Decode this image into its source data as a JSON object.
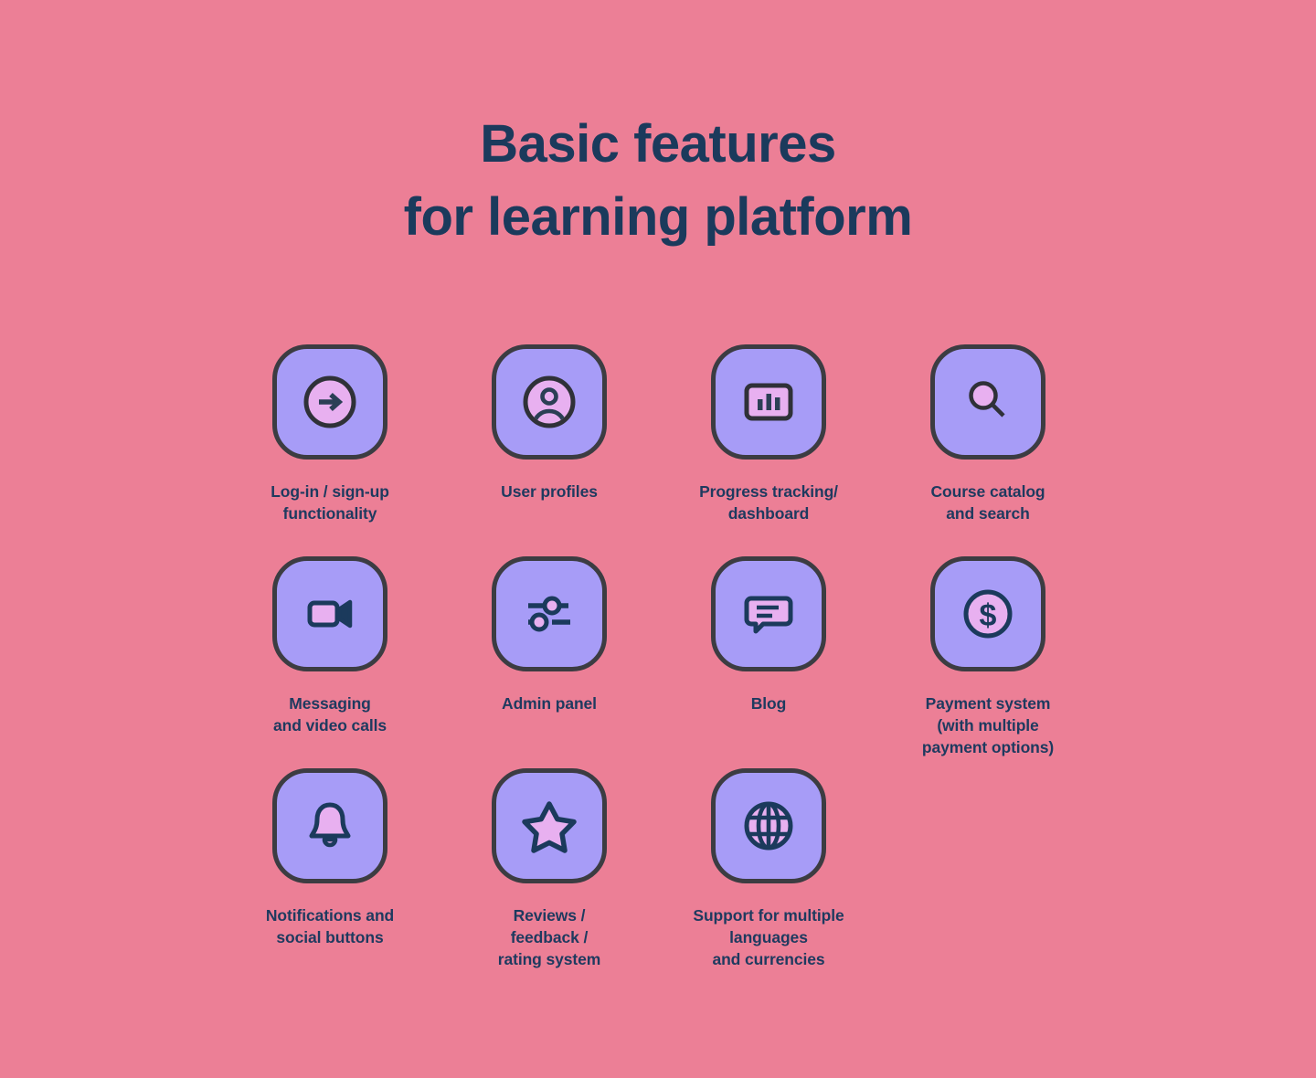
{
  "theme": {
    "background": "#ec7f96",
    "tile_fill": "#a79cf7",
    "tile_border": "#3c3c42",
    "icon_stroke": "#1b3a5c",
    "icon_accent": "#e8b0f0",
    "text": "#1e3a5f"
  },
  "header": {
    "title_line1": "Basic features",
    "title_line2": "for learning platform"
  },
  "features": [
    {
      "icon": "arrow-right-circle-icon",
      "caption_lines": [
        "Log-in / sign-up",
        "functionality"
      ]
    },
    {
      "icon": "user-profile-icon",
      "caption_lines": [
        "User profiles"
      ]
    },
    {
      "icon": "bar-chart-dashboard-icon",
      "caption_lines": [
        "Progress tracking/",
        "dashboard"
      ]
    },
    {
      "icon": "search-magnifier-icon",
      "caption_lines": [
        "Course catalog",
        "and search"
      ]
    },
    {
      "icon": "video-camera-icon",
      "caption_lines": [
        "Messaging",
        "and video calls"
      ]
    },
    {
      "icon": "sliders-settings-icon",
      "caption_lines": [
        "Admin panel"
      ]
    },
    {
      "icon": "chat-bubble-icon",
      "caption_lines": [
        "Blog"
      ]
    },
    {
      "icon": "dollar-coin-icon",
      "caption_lines": [
        "Payment system",
        "(with multiple",
        "payment options)"
      ]
    },
    {
      "icon": "bell-notification-icon",
      "caption_lines": [
        "Notifications and",
        "social buttons"
      ]
    },
    {
      "icon": "star-rating-icon",
      "caption_lines": [
        "Reviews /",
        "feedback /",
        "rating system"
      ]
    },
    {
      "icon": "globe-languages-icon",
      "caption_lines": [
        "Support for multiple",
        "languages",
        "and currencies"
      ]
    }
  ]
}
